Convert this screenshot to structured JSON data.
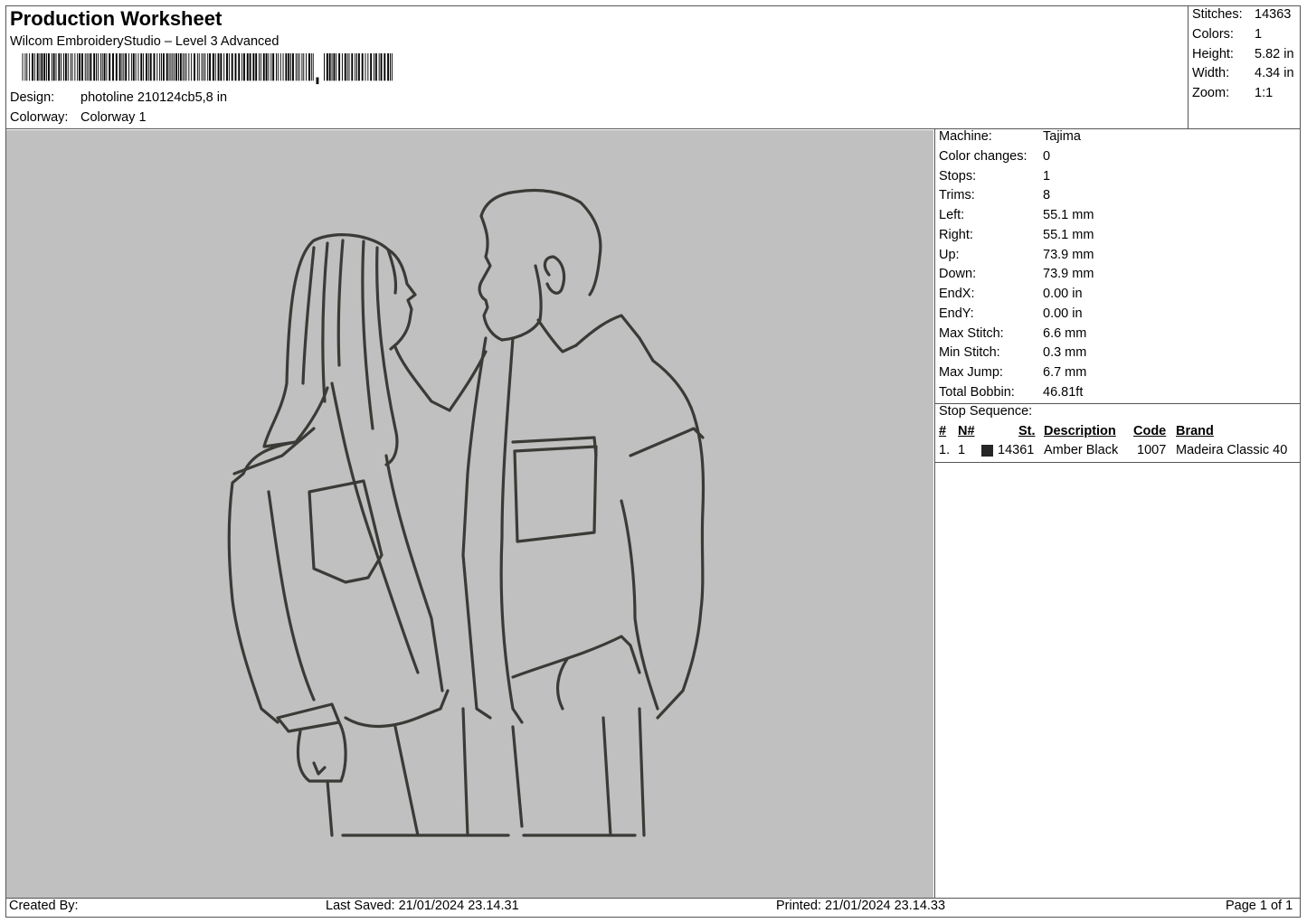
{
  "header": {
    "title": "Production Worksheet",
    "software": "Wilcom EmbroideryStudio – Level 3 Advanced",
    "design_label": "Design:",
    "design_value": "photoline 210124cb5,8 in",
    "colorway_label": "Colorway:",
    "colorway_value": "Colorway 1"
  },
  "stats": [
    {
      "label": "Stitches:",
      "value": "14363"
    },
    {
      "label": "Colors:",
      "value": "1"
    },
    {
      "label": "Height:",
      "value": "5.82 in"
    },
    {
      "label": "Width:",
      "value": "4.34 in"
    },
    {
      "label": "Zoom:",
      "value": "1:1"
    }
  ],
  "machine_info": [
    {
      "label": "Machine:",
      "value": "Tajima"
    },
    {
      "label": "Color changes:",
      "value": "0"
    },
    {
      "label": "Stops:",
      "value": "1"
    },
    {
      "label": "Trims:",
      "value": "8"
    },
    {
      "label": "Left:",
      "value": "55.1 mm"
    },
    {
      "label": "Right:",
      "value": "55.1 mm"
    },
    {
      "label": "Up:",
      "value": "73.9 mm"
    },
    {
      "label": "Down:",
      "value": "73.9 mm"
    },
    {
      "label": "EndX:",
      "value": "0.00 in"
    },
    {
      "label": "EndY:",
      "value": "0.00 in"
    },
    {
      "label": "Max Stitch:",
      "value": "6.6 mm"
    },
    {
      "label": "Min Stitch:",
      "value": "0.3 mm"
    },
    {
      "label": "Max Jump:",
      "value": "6.7 mm"
    },
    {
      "label": "Total Bobbin:",
      "value": "46.81ft"
    }
  ],
  "stop_sequence": {
    "label": "Stop Sequence:",
    "columns": {
      "num": "#",
      "needle": "N#",
      "stitches": "St.",
      "description": "Description",
      "code": "Code",
      "brand": "Brand"
    },
    "rows": [
      {
        "num": "1.",
        "needle": "1",
        "swatch_color": "#262626",
        "stitches": "14361",
        "description": "Amber Black",
        "code": "1007",
        "brand": "Madeira Classic 40"
      }
    ]
  },
  "footer": {
    "created_by": "Created By:",
    "last_saved": "Last Saved: 21/01/2024 23.14.31",
    "printed": "Printed: 21/01/2024 23.14.33",
    "page": "Page 1 of 1"
  },
  "colors": {
    "preview_background": "#c0c0c0",
    "thread": "#3a3a37"
  }
}
